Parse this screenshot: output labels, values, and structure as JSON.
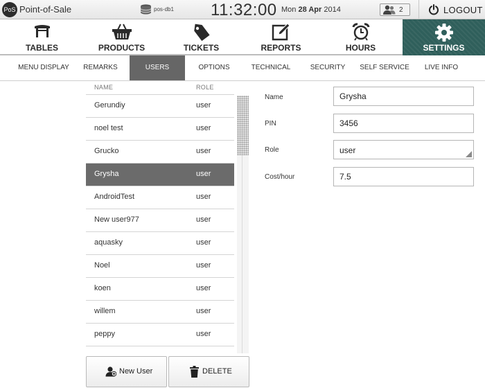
{
  "topbar": {
    "logo_text": "PoS",
    "app_title": "Point-of-Sale",
    "db_name": "pos-db1",
    "clock": "11:32:00",
    "date_prefix": "Mon",
    "date_bold": "28 Apr",
    "date_suffix": "2014",
    "online_users_count": "2",
    "logout_label": "LOGOUT"
  },
  "main_nav": [
    {
      "label": "TABLES",
      "icon": "table-icon"
    },
    {
      "label": "PRODUCTS",
      "icon": "basket-icon"
    },
    {
      "label": "TICKETS",
      "icon": "tag-icon"
    },
    {
      "label": "REPORTS",
      "icon": "edit-icon"
    },
    {
      "label": "HOURS",
      "icon": "alarm-clock-icon"
    },
    {
      "label": "SETTINGS",
      "icon": "gear-icon",
      "active": true
    }
  ],
  "sub_nav": [
    {
      "label": "MENU DISPLAY"
    },
    {
      "label": "REMARKS"
    },
    {
      "label": "USERS",
      "active": true
    },
    {
      "label": "OPTIONS"
    },
    {
      "label": "TECHNICAL"
    },
    {
      "label": "SECURITY"
    },
    {
      "label": "SELF SERVICE"
    },
    {
      "label": "LIVE INFO"
    }
  ],
  "users_list": {
    "headers": {
      "name": "NAME",
      "role": "ROLE"
    },
    "rows": [
      {
        "name": "Gerundiy",
        "role": "user"
      },
      {
        "name": "noel test",
        "role": "user"
      },
      {
        "name": "Grucko",
        "role": "user"
      },
      {
        "name": "Grysha",
        "role": "user",
        "selected": true
      },
      {
        "name": "AndroidTest",
        "role": "user"
      },
      {
        "name": "New user977",
        "role": "user"
      },
      {
        "name": "aquasky",
        "role": "user"
      },
      {
        "name": "Noel",
        "role": "user"
      },
      {
        "name": "koen",
        "role": "user"
      },
      {
        "name": "willem",
        "role": "user"
      },
      {
        "name": "peppy",
        "role": "user"
      },
      {
        "name": "",
        "role": ""
      }
    ],
    "new_user_label": "New User",
    "delete_label": "DELETE"
  },
  "details": {
    "name_label": "Name",
    "name_value": "Grysha",
    "pin_label": "PIN",
    "pin_value": "3456",
    "role_label": "Role",
    "role_value": "user",
    "cost_label": "Cost/hour",
    "cost_value": "7.5"
  },
  "colors": {
    "active_nav_bg": "#2f5f5b",
    "active_subtab_bg": "#666666",
    "selected_row_bg": "#6b6b6b"
  }
}
